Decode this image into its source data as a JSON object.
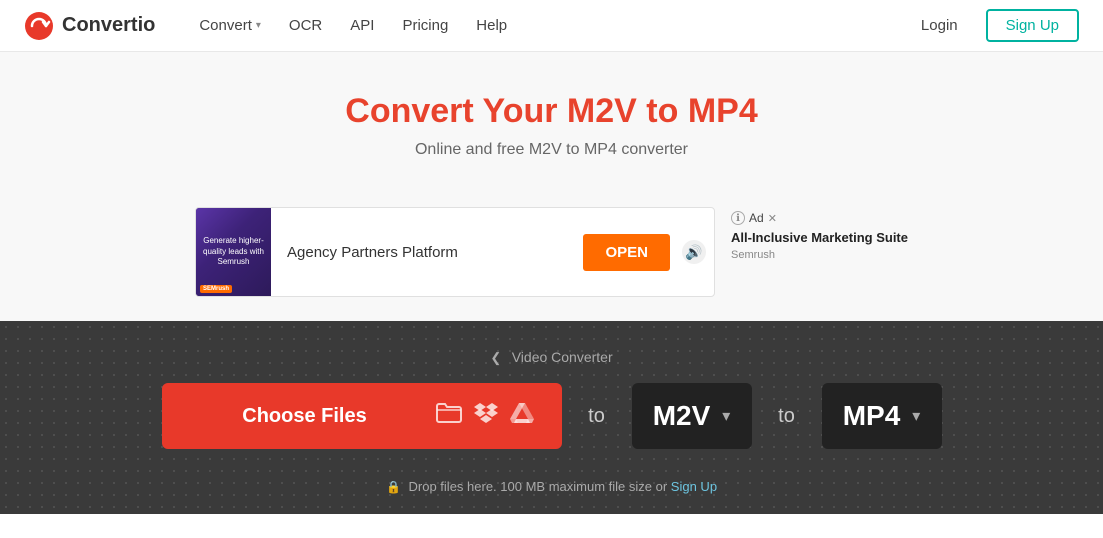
{
  "header": {
    "logo_text": "Convertio",
    "nav": [
      {
        "label": "Convert",
        "has_dropdown": true
      },
      {
        "label": "OCR",
        "has_dropdown": false
      },
      {
        "label": "API",
        "has_dropdown": false
      },
      {
        "label": "Pricing",
        "has_dropdown": false
      },
      {
        "label": "Help",
        "has_dropdown": false
      }
    ],
    "login_label": "Login",
    "signup_label": "Sign Up"
  },
  "hero": {
    "title": "Convert Your M2V to MP4",
    "subtitle": "Online and free M2V to MP4 converter"
  },
  "ad": {
    "image_text": "Generate higher-quality leads with Semrush",
    "brand_tag": "SEMrush",
    "content_text": "Agency Partners Platform",
    "open_btn_label": "OPEN",
    "side_title": "All-Inclusive Marketing Suite",
    "side_brand": "Semrush",
    "info_label": "Ad"
  },
  "converter": {
    "breadcrumb_label": "Video Converter",
    "choose_files_label": "Choose Files",
    "to_label": "to",
    "from_format": "M2V",
    "to_format": "MP4",
    "drop_info_text": "Drop files here. 100 MB maximum file size or",
    "drop_signup_link": "Sign Up"
  }
}
